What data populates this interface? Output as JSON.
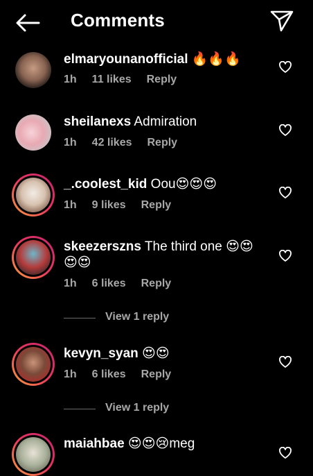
{
  "header": {
    "title": "Comments"
  },
  "comments": [
    {
      "username": "elmaryounanofficial",
      "text": " 🔥🔥🔥",
      "time": "1h",
      "likes": "11 likes",
      "reply": "Reply"
    },
    {
      "username": "sheilanexs",
      "text": " Admiration",
      "time": "1h",
      "likes": "42 likes",
      "reply": "Reply"
    },
    {
      "username": "_.coolest_kid",
      "text": " Oou😍😍😍",
      "time": "1h",
      "likes": "9 likes",
      "reply": "Reply"
    },
    {
      "username": "skeezerszns",
      "text": " The third one 😍😍😍😍",
      "time": "1h",
      "likes": "6 likes",
      "reply": "Reply"
    },
    {
      "username": "kevyn_syan",
      "text": " 😍😍",
      "time": "1h",
      "likes": "6 likes",
      "reply": "Reply"
    },
    {
      "username": "maiahbae",
      "text": " 😍😍😢meg",
      "time": "",
      "likes": "",
      "reply": ""
    }
  ],
  "view_replies": [
    "View 1 reply",
    "View 1 reply"
  ],
  "colors": {
    "background": "#000000",
    "text": "#ffffff",
    "meta": "#a8a8a8",
    "story_ring_start": "#f9a23a",
    "story_ring_end": "#c3256f"
  }
}
